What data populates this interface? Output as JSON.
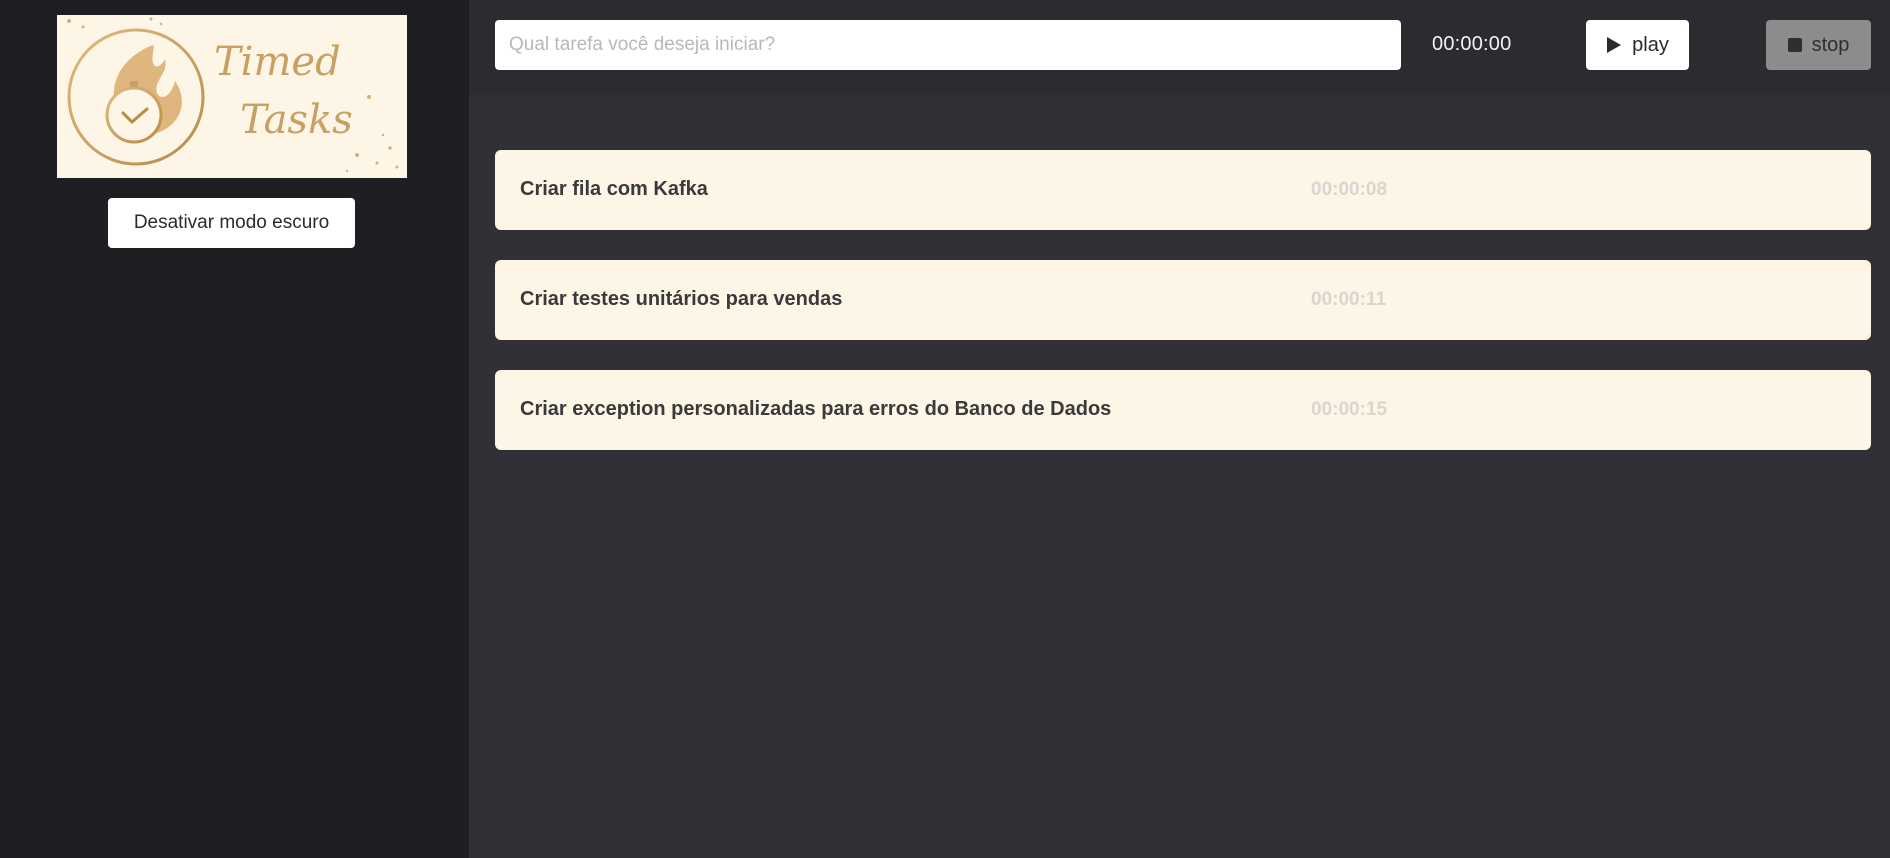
{
  "sidebar": {
    "logo": {
      "line1": "Timed",
      "line2": "Tasks",
      "icon": "clock-flame-logo"
    },
    "theme_toggle_label": "Desativar modo escuro"
  },
  "topbar": {
    "task_input": {
      "value": "",
      "placeholder": "Qual tarefa você deseja iniciar?"
    },
    "timer": "00:00:00",
    "play_label": "play",
    "play_icon": "play-icon",
    "stop_label": "stop",
    "stop_icon": "stop-icon"
  },
  "tasks": [
    {
      "name": "Criar fila com Kafka",
      "time": "00:00:08"
    },
    {
      "name": "Criar testes unitários para vendas",
      "time": "00:00:11"
    },
    {
      "name": "Criar exception personalizadas para erros do Banco de Dados",
      "time": "00:00:15"
    }
  ],
  "colors": {
    "sidebar_bg": "#1f1e23",
    "main_bg": "#313036",
    "card_bg": "#fdf5e6",
    "logo_gold": "#c9a063",
    "stop_disabled": "#8c8c8c"
  }
}
